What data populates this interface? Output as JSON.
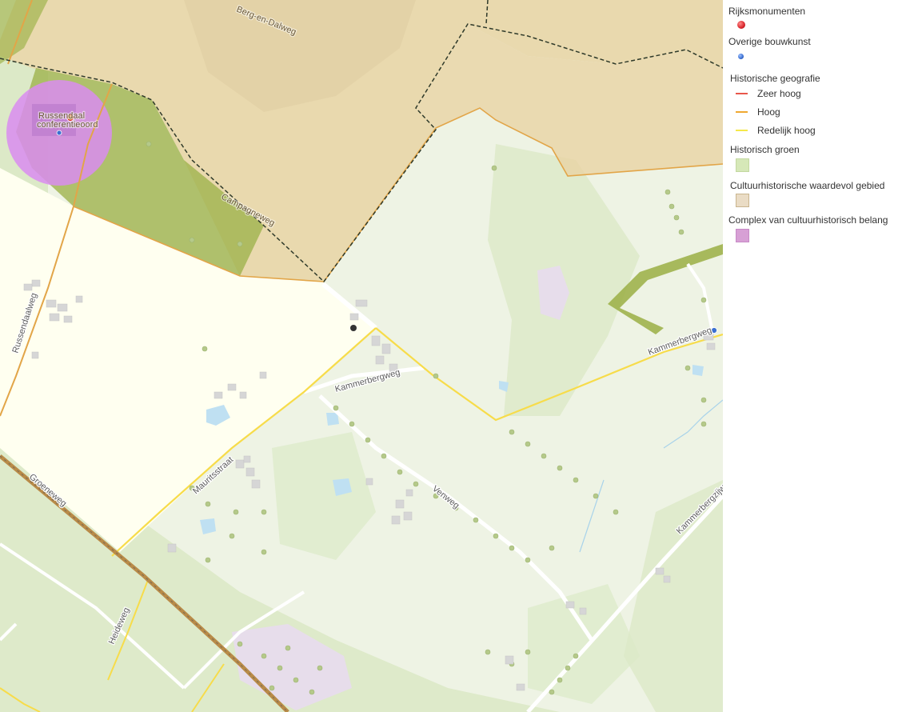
{
  "map": {
    "labels": {
      "berg_en_dalweg": "Berg-en-Dalweg",
      "russendaal_line1": "Russendaal",
      "russendaal_line2": "conferentieoord",
      "campagneweg": "Campagneweg",
      "russendaalweg": "Russendaalweg",
      "kammerbergweg_west": "Kammerbergweg",
      "kammerbergweg_east": "Kammerbergweg",
      "mauritsstraat": "Mauritsstraat",
      "venweg": "Venweg",
      "groeneweg": "Groeneweg",
      "heideweg": "Heideweg",
      "kammerbergzijweg": "Kammerbergzijweg"
    },
    "colors": {
      "base_green": "#eef3e4",
      "woodland": "#dce9c7",
      "cultural_area": "#e8d3a4",
      "historic_green": "#9fb34d",
      "complex_circle": "#d98cf0",
      "yellow_field": "#fffff0",
      "road_yellow": "#f7dc4a",
      "route_orange": "#e2a548",
      "railway": "#b98b48",
      "boundary": "#2f3a2a"
    }
  },
  "legend": {
    "rijksmonumenten": {
      "title": "Rijksmonumenten",
      "color": "#d9262c",
      "icon": "red-dot-icon"
    },
    "overige_bouwkunst": {
      "title": "Overige bouwkunst",
      "color": "#3b6fd1",
      "icon": "blue-dot-icon"
    },
    "historische_geografie": {
      "title": "Historische geografie",
      "items": [
        {
          "label": "Zeer hoog",
          "color": "#e8574b"
        },
        {
          "label": "Hoog",
          "color": "#f0a830"
        },
        {
          "label": "Redelijk hoog",
          "color": "#f5e84a"
        }
      ]
    },
    "historisch_groen": {
      "title": "Historisch groen",
      "color": "#d6e8b8",
      "border": "#c3d8a0"
    },
    "cultuurhistorische": {
      "title": "Cultuurhistorische waardevol gebied",
      "color": "#eadcc5",
      "border": "#c9b58f"
    },
    "complex": {
      "title": "Complex van cultuurhistorisch belang",
      "color": "#d7a0d5",
      "border": "#c78ac6"
    }
  }
}
